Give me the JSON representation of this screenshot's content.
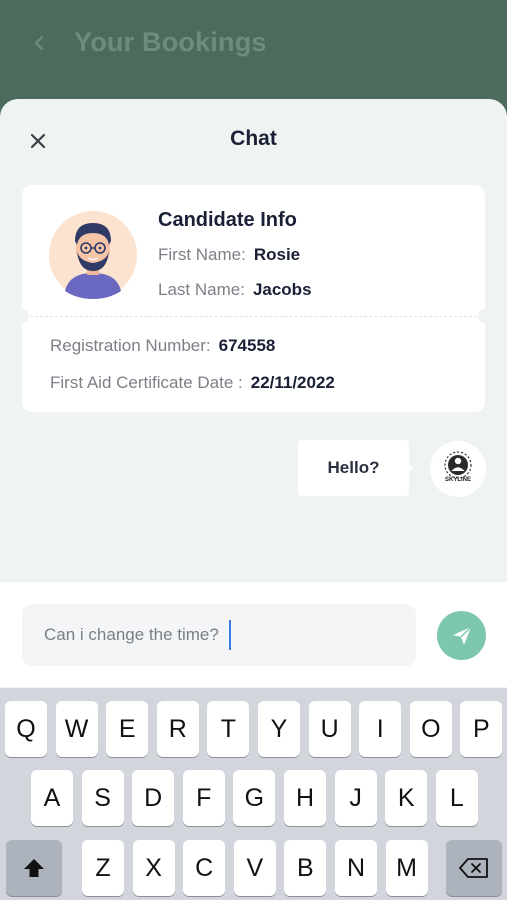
{
  "header": {
    "title": "Your Bookings"
  },
  "chat": {
    "title": "Chat"
  },
  "candidate": {
    "heading": "Candidate Info",
    "first_name_label": "First Name:",
    "first_name": "Rosie",
    "last_name_label": "Last Name:",
    "last_name": "Jacobs",
    "registration_label": "Registration Number:",
    "registration_number": "674558",
    "first_aid_label": "First Aid Certificate Date :",
    "first_aid_date": "22/11/2022"
  },
  "messages": [
    {
      "text": "Hello?",
      "sender_logo": "SKYLINE"
    }
  ],
  "composer": {
    "value": "Can i change the time?"
  },
  "keyboard": {
    "row1": [
      "Q",
      "W",
      "E",
      "R",
      "T",
      "Y",
      "U",
      "I",
      "O",
      "P"
    ],
    "row2": [
      "A",
      "S",
      "D",
      "F",
      "G",
      "H",
      "J",
      "K",
      "L"
    ],
    "row3": [
      "Z",
      "X",
      "C",
      "V",
      "B",
      "N",
      "M"
    ]
  },
  "colors": {
    "header_bg": "#4c6b5c",
    "sheet_bg": "#eff3f2",
    "send_button": "#7dc7b0",
    "text_dark": "#1a2136",
    "caret": "#3a7bdc"
  },
  "icons": {
    "back": "chevron-left-icon",
    "close": "close-icon",
    "send": "send-icon",
    "shift": "shift-icon",
    "delete": "backspace-icon"
  }
}
